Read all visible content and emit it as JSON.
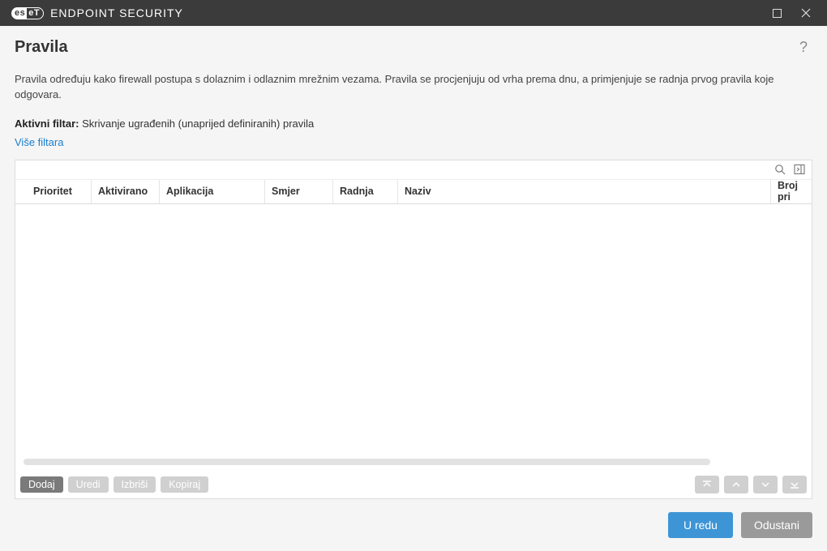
{
  "titlebar": {
    "logo_left": "es",
    "logo_right": "eT",
    "product": "ENDPOINT SECURITY"
  },
  "page": {
    "title": "Pravila",
    "description": "Pravila određuju kako firewall postupa s dolaznim i odlaznim mrežnim vezama. Pravila se procjenjuju od vrha prema dnu, a primjenjuje se radnja prvog pravila koje odgovara.",
    "filter_label": "Aktivni filtar:",
    "filter_value": "Skrivanje ugrađenih (unaprijed definiranih) pravila",
    "more_filters": "Više filtara"
  },
  "columns": {
    "prioritet": "Prioritet",
    "aktivirano": "Aktivirano",
    "aplikacija": "Aplikacija",
    "smjer": "Smjer",
    "radnja": "Radnja",
    "naziv": "Naziv",
    "broj": "Broj pri"
  },
  "actions": {
    "dodaj": "Dodaj",
    "uredi": "Uredi",
    "izbrisi": "Izbriši",
    "kopiraj": "Kopiraj"
  },
  "footer": {
    "ok": "U redu",
    "cancel": "Odustani"
  }
}
